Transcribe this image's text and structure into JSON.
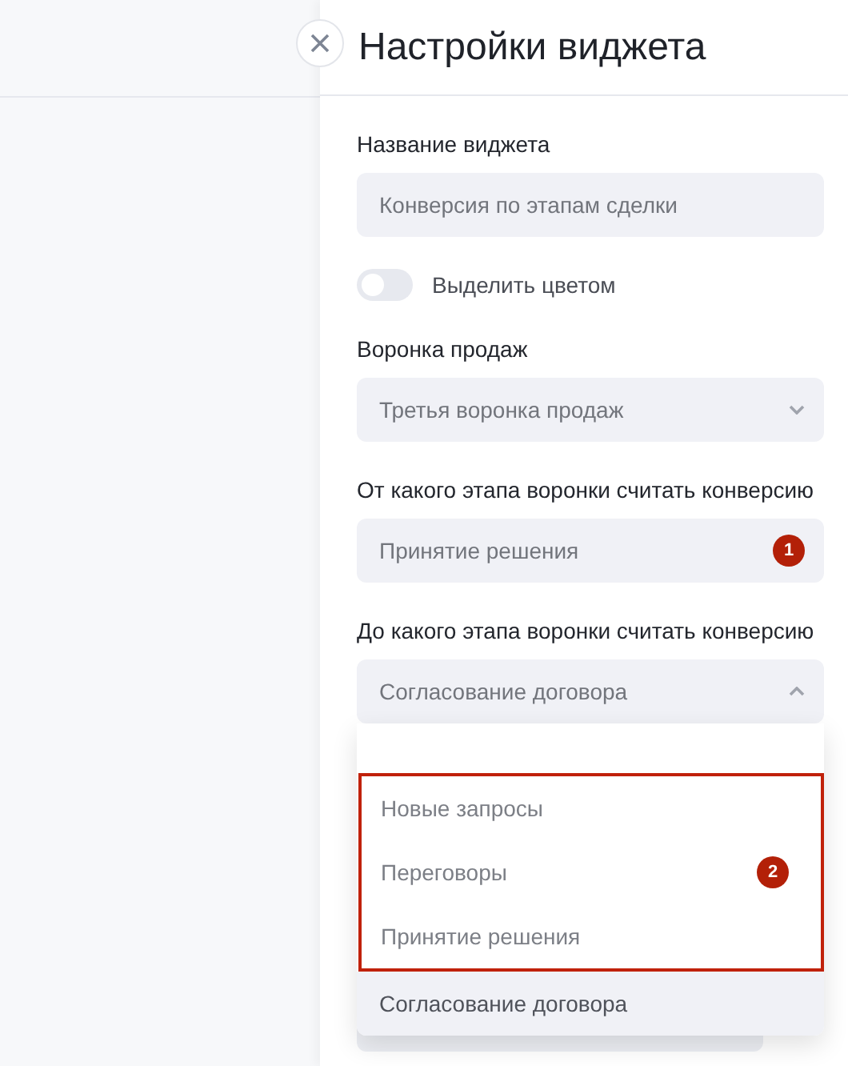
{
  "panel": {
    "title": "Настройки виджета",
    "name_field": {
      "label": "Название виджета",
      "value": "Конверсия по этапам сделки"
    },
    "highlight_toggle": {
      "label": "Выделить цветом",
      "on": false
    },
    "funnel_select": {
      "label": "Воронка продаж",
      "value": "Третья воронка продаж",
      "expanded": false
    },
    "from_stage_select": {
      "label": "От какого этапа воронки считать конверсию",
      "value": "Принятие решения",
      "badge": "1"
    },
    "to_stage_select": {
      "label": "До какого этапа воронки считать конверсию",
      "value": "Согласование договора",
      "expanded": true,
      "options_badge": "2",
      "options": [
        {
          "label": "Новые запросы",
          "highlighted": true,
          "selected": false
        },
        {
          "label": "Переговоры",
          "highlighted": true,
          "selected": false
        },
        {
          "label": "Принятие решения",
          "highlighted": true,
          "selected": false
        },
        {
          "label": "Согласование договора",
          "highlighted": false,
          "selected": true
        }
      ]
    }
  }
}
